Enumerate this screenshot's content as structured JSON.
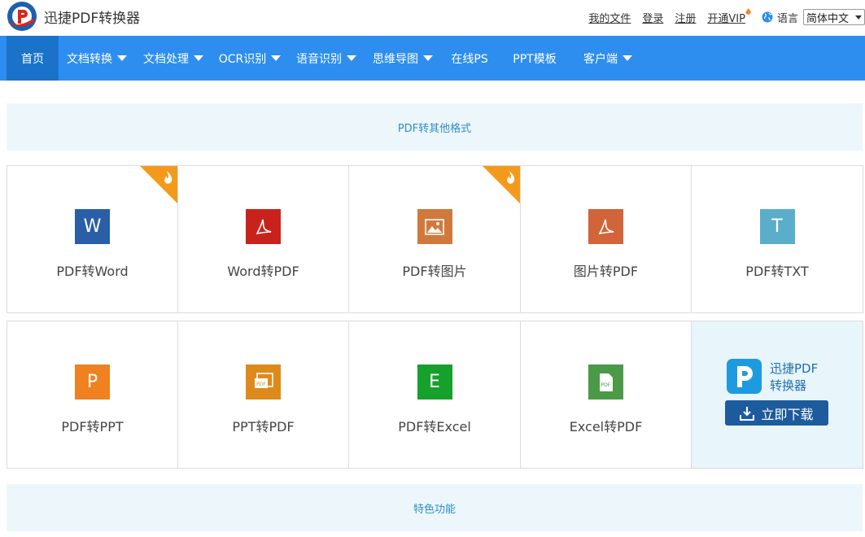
{
  "brand": {
    "name": "迅捷PDF转换器"
  },
  "toplinks": {
    "my_files": "我的文件",
    "login": "登录",
    "register": "注册",
    "vip": "开通VIP",
    "language_label": "语言",
    "language_value": "简体中文"
  },
  "nav": {
    "items": [
      {
        "label": "首页",
        "dropdown": false,
        "active": true
      },
      {
        "label": "文档转换",
        "dropdown": true
      },
      {
        "label": "文档处理",
        "dropdown": true
      },
      {
        "label": "OCR识别",
        "dropdown": true
      },
      {
        "label": "语音识别",
        "dropdown": true
      },
      {
        "label": "思维导图",
        "dropdown": true
      },
      {
        "label": "在线PS",
        "dropdown": false
      },
      {
        "label": "PPT模板",
        "dropdown": false
      },
      {
        "label": "客户端",
        "dropdown": true
      }
    ]
  },
  "sections": {
    "pdf_to_other": "PDF转其他格式",
    "features": "特色功能"
  },
  "tools_row1": [
    {
      "label": "PDF转Word",
      "icon_letter": "W",
      "color": "#2a5fa8",
      "hot": true
    },
    {
      "label": "Word转PDF",
      "icon": "pdf-acrobat-icon",
      "color": "#c7231c",
      "hot": false
    },
    {
      "label": "PDF转图片",
      "icon": "image-icon",
      "color": "#cf7a3c",
      "hot": true
    },
    {
      "label": "图片转PDF",
      "icon": "pdf-acrobat-icon",
      "color": "#d2643a",
      "hot": false
    },
    {
      "label": "PDF转TXT",
      "icon_letter": "T",
      "color": "#5aaec9",
      "hot": false
    }
  ],
  "tools_row2": [
    {
      "label": "PDF转PPT",
      "icon_letter": "P",
      "color": "#f08120"
    },
    {
      "label": "PPT转PDF",
      "icon": "ppt-pdf-icon",
      "color": "#de8a1a"
    },
    {
      "label": "PDF转Excel",
      "icon_letter": "E",
      "color": "#16a02c"
    },
    {
      "label": "Excel转PDF",
      "icon": "pdf-file-icon",
      "color": "#4a9a47"
    }
  ],
  "download": {
    "name_line1": "迅捷PDF",
    "name_line2": "转换器",
    "button": "立即下载"
  },
  "colors": {
    "nav_bg": "#2d8ef0",
    "nav_active": "#1a73c9",
    "banner_bg": "#edf7fb",
    "hot_corner": "#f39a1c"
  }
}
